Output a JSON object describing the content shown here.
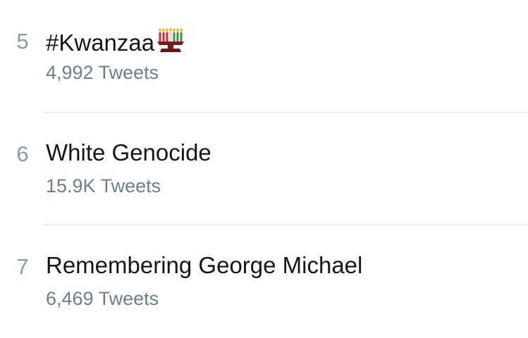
{
  "trends": [
    {
      "rank": "5",
      "topic": "#Kwanzaa",
      "topic_icon": "kinara-icon",
      "count": "4,992 Tweets"
    },
    {
      "rank": "6",
      "topic": "White Genocide",
      "count": "15.9K Tweets"
    },
    {
      "rank": "7",
      "topic": "Remembering George Michael",
      "count": "6,469 Tweets"
    }
  ],
  "colors": {
    "topic_text": "#14171a",
    "secondary_text": "#6b7f91",
    "rank_text": "#8899a6",
    "divider": "#dfe3e6",
    "kinara_candles": [
      "#d4293b",
      "#d4293b",
      "#d4293b",
      "#ffffff",
      "#3d8f4a",
      "#3d8f4a",
      "#3d8f4a"
    ],
    "kinara_base": "#7a1b1b"
  }
}
